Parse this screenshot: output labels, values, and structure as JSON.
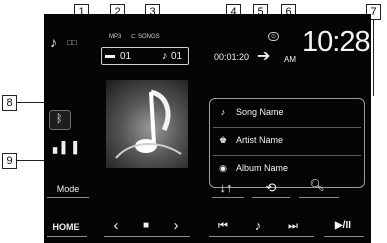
{
  "callouts": [
    "1",
    "2",
    "3",
    "4",
    "5",
    "6",
    "7",
    "8",
    "9"
  ],
  "status": {
    "codec": "MP3",
    "song_count": "SONGS",
    "play_time": "00:01:20",
    "ampm": "AM",
    "clock": "10:28"
  },
  "folder": {
    "folder_no": "01",
    "track_no": "01"
  },
  "tags": {
    "song": "Song Name",
    "artist": "Artist Name",
    "album": "Album Name"
  },
  "controls": {
    "mode_label": "Mode",
    "home_label": "HOME",
    "play_pause_label": "▶/II"
  },
  "icons": [
    "bluetooth-icon",
    "equalizer-icon",
    "note-icon",
    "folder-icon",
    "repeat-icon",
    "search-icon",
    "skip-back-icon",
    "skip-forward-icon",
    "camera-icon",
    "power-icon"
  ]
}
